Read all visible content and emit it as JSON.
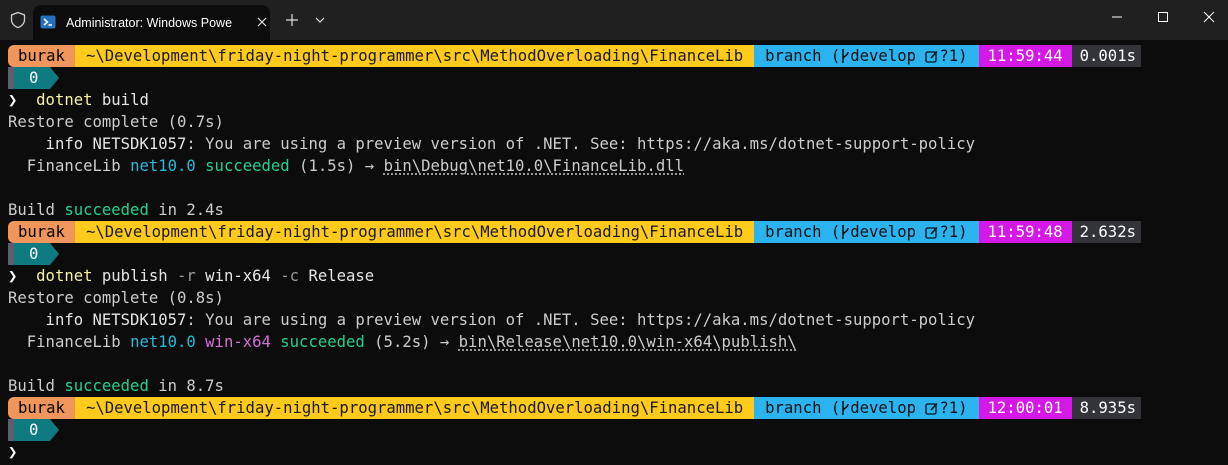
{
  "window": {
    "tab_title": "Administrator: Windows Powe",
    "new_tab_label": "+"
  },
  "prompts": [
    {
      "user": "burak",
      "path": "~\\Development\\friday-night-programmer\\src\\MethodOverloading\\FinanceLib",
      "git_label": "branch (",
      "git_branch": "develop",
      "git_tail": "?1)",
      "time": "11:59:44",
      "duration": "0.001s",
      "exit_code": "0"
    },
    {
      "user": "burak",
      "path": "~\\Development\\friday-night-programmer\\src\\MethodOverloading\\FinanceLib",
      "git_label": "branch (",
      "git_branch": "develop",
      "git_tail": "?1)",
      "time": "11:59:48",
      "duration": "2.632s",
      "exit_code": "0"
    },
    {
      "user": "burak",
      "path": "~\\Development\\friday-night-programmer\\src\\MethodOverloading\\FinanceLib",
      "git_label": "branch (",
      "git_branch": "develop",
      "git_tail": "?1)",
      "time": "12:00:01",
      "duration": "8.935s",
      "exit_code": "0"
    }
  ],
  "prompt_char": "❯",
  "run1": {
    "cmd": "dotnet",
    "args": "build",
    "restore": "Restore complete (0.7s)",
    "info_prefix": "    info NETSDK1057",
    "info_text": ": You are using a preview version of .NET. See: https://aka.ms/dotnet-support-policy",
    "proj": "  FinanceLib ",
    "framework": "net10.0",
    "status": "succeeded",
    "timing": " (1.5s) → ",
    "output": "bin\\Debug\\net10.0\\FinanceLib.dll",
    "build_label": "Build ",
    "build_status": "succeeded",
    "build_time": " in 2.4s"
  },
  "run2": {
    "cmd": "dotnet",
    "args_a": "publish ",
    "flag_r": "-r",
    "args_b": " win-x64 ",
    "flag_c": "-c",
    "args_c": " Release",
    "restore": "Restore complete (0.8s)",
    "info_prefix": "    info NETSDK1057",
    "info_text": ": You are using a preview version of .NET. See: https://aka.ms/dotnet-support-policy",
    "proj": "  FinanceLib ",
    "framework": "net10.0",
    "runtime": "win-x64",
    "status": "succeeded",
    "timing": " (5.2s) → ",
    "output": "bin\\Release\\net10.0\\win-x64\\publish\\",
    "build_label": "Build ",
    "build_status": "succeeded",
    "build_time": " in 8.7s"
  },
  "colors": {
    "user_segment": "#f0965a",
    "path_segment": "#ffca1c",
    "git_segment": "#2bb3ef",
    "time_segment": "#d418e6",
    "duration_segment": "#33333c",
    "exit_segment": "#0f7a80",
    "success": "#23d18b",
    "framework": "#29b8db",
    "runtime": "#d670d6",
    "command": "#f9f1a5"
  },
  "icons": {
    "shield": "shield-icon",
    "powershell": "powershell-icon",
    "git_branch": "git-branch-icon",
    "git_edit": "edit-icon"
  }
}
